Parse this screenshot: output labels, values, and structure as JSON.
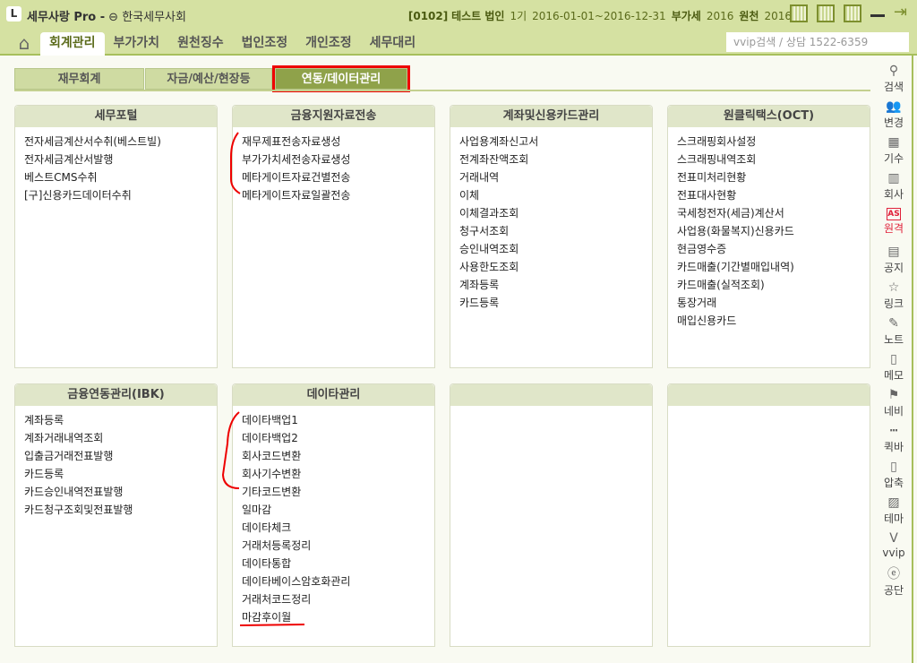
{
  "app": {
    "logo": "L",
    "title": "세무사랑 Pro -",
    "org": "한국세무사회"
  },
  "company": {
    "code": "[0102]",
    "name": "테스트 법인",
    "period_label": "1기",
    "period": "2016-01-01~2016-12-31",
    "vat_label": "부가세",
    "vat_year": "2016",
    "wh_label": "원천",
    "wh_year": "2016"
  },
  "nav": {
    "tabs": [
      "회계관리",
      "부가가치",
      "원천징수",
      "법인조정",
      "개인조정",
      "세무대리"
    ],
    "active": 0
  },
  "search": {
    "placeholder": "vvip검색 / 상담 1522-6359"
  },
  "subtabs": [
    "재무회계",
    "자금/예산/현장등",
    "연동/데이터관리"
  ],
  "active_subtab": 2,
  "panels": [
    {
      "title": "세무포털",
      "items": [
        "전자세금계산서수취(베스트빌)",
        "전자세금계산서발행",
        "베스트CMS수취",
        "[구]신용카드데이터수취"
      ]
    },
    {
      "title": "금융지원자료전송",
      "items": [
        "재무제표전송자료생성",
        "부가가치세전송자료생성",
        "메타게이트자료건별전송",
        "메타게이트자료일괄전송"
      ]
    },
    {
      "title": "계좌및신용카드관리",
      "items": [
        "사업용계좌신고서",
        "전계좌잔액조회",
        "거래내역",
        "이체",
        "이체결과조회",
        "청구서조회",
        "승인내역조회",
        "사용한도조회",
        "계좌등록",
        "카드등록"
      ]
    },
    {
      "title": "원클릭택스(OCT)",
      "items": [
        "스크래핑회사설정",
        "스크래핑내역조회",
        "전표미처리현황",
        "전표대사현황",
        "국세청전자(세금)계산서",
        "사업용(화물복지)신용카드",
        "현금영수증",
        "카드매출(기간별매입내역)",
        "카드매출(실적조회)",
        "통장거래",
        "매입신용카드"
      ]
    },
    {
      "title": "금융연동관리(IBK)",
      "items": [
        "계좌등록",
        "계좌거래내역조회",
        "입출금거래전표발행",
        "카드등록",
        "카드승인내역전표발행",
        "카드청구조회및전표발행"
      ]
    },
    {
      "title": "데이타관리",
      "items": [
        "데이타백업1",
        "데이타백업2",
        "회사코드변환",
        "회사기수변환",
        "기타코드변환",
        "일마감",
        "데이타체크",
        "거래처등록정리",
        "데이타통합",
        "데이타베이스암호화관리",
        "거래처코드정리",
        "마감후이월"
      ]
    },
    {
      "title": "",
      "items": []
    },
    {
      "title": "",
      "items": []
    }
  ],
  "sidebar": [
    {
      "label": "검색",
      "icon": "search-icon"
    },
    {
      "label": "변경",
      "icon": "users-icon"
    },
    {
      "label": "기수",
      "icon": "calendar-icon"
    },
    {
      "label": "회사",
      "icon": "building-icon"
    },
    {
      "label": "원격",
      "icon": "remote-as-icon",
      "color": "#e0203a"
    },
    {
      "label": "공지",
      "icon": "news-icon"
    },
    {
      "label": "링크",
      "icon": "star-icon"
    },
    {
      "label": "노트",
      "icon": "pin-note-icon"
    },
    {
      "label": "메모",
      "icon": "memo-icon"
    },
    {
      "label": "네비",
      "icon": "signpost-icon"
    },
    {
      "label": "퀵바",
      "icon": "quickbar-icon"
    },
    {
      "label": "압축",
      "icon": "zip-icon"
    },
    {
      "label": "테마",
      "icon": "image-icon"
    },
    {
      "label": "vvip",
      "icon": "vvip-icon"
    },
    {
      "label": "공단",
      "icon": "e-icon"
    }
  ],
  "colors": {
    "titlebar": "#d5e1a2",
    "active_subtab": "#8fa24a",
    "panel_header": "#e0e6c9",
    "annotation": "#e00000"
  }
}
